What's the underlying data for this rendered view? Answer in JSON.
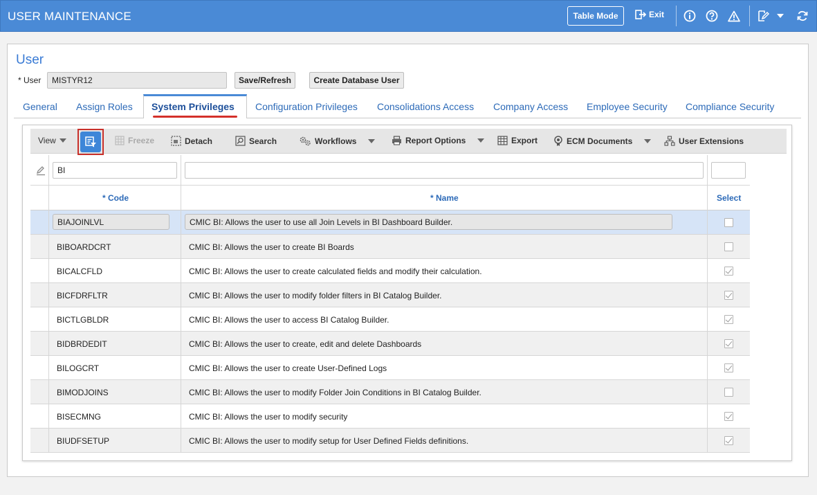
{
  "app": {
    "title": "USER MAINTENANCE",
    "table_mode_label": "Table Mode",
    "exit_label": "Exit"
  },
  "form": {
    "section_title": "User",
    "user_label": "* User",
    "user_value": "MISTYR12",
    "save_refresh_label": "Save/Refresh",
    "create_db_user_label": "Create Database User"
  },
  "tabs": [
    {
      "label": "General"
    },
    {
      "label": "Assign Roles"
    },
    {
      "label": "System Privileges",
      "active": true
    },
    {
      "label": "Configuration Privileges"
    },
    {
      "label": "Consolidations Access"
    },
    {
      "label": "Company Access"
    },
    {
      "label": "Employee Security"
    },
    {
      "label": "Compliance Security"
    }
  ],
  "toolbar": {
    "view_label": "View",
    "freeze_label": "Freeze",
    "detach_label": "Detach",
    "search_label": "Search",
    "workflows_label": "Workflows",
    "report_options_label": "Report Options",
    "export_label": "Export",
    "ecm_documents_label": "ECM Documents",
    "user_extensions_label": "User Extensions"
  },
  "grid": {
    "filter": {
      "code": "BI",
      "name": "",
      "select": ""
    },
    "headers": {
      "code": "* Code",
      "name": "* Name",
      "select": "Select"
    },
    "rows": [
      {
        "code": "BIAJOINLVL",
        "name": "CMIC BI: Allows the user to use all Join Levels in BI Dashboard Builder.",
        "selected": false
      },
      {
        "code": "BIBOARDCRT",
        "name": "CMIC BI: Allows the user to create BI Boards",
        "selected": false
      },
      {
        "code": "BICALCFLD",
        "name": "CMIC BI: Allows the user to create calculated fields and modify their calculation.",
        "selected": true
      },
      {
        "code": "BICFDRFLTR",
        "name": "CMIC BI: Allows the user to modify folder filters in BI Catalog Builder.",
        "selected": true
      },
      {
        "code": "BICTLGBLDR",
        "name": "CMIC BI: Allows the user to access BI Catalog Builder.",
        "selected": true
      },
      {
        "code": "BIDBRDEDIT",
        "name": "CMIC BI: Allows the user to create, edit and delete Dashboards",
        "selected": true
      },
      {
        "code": "BILOGCRT",
        "name": "CMIC BI: Allows the user to create User-Defined Logs",
        "selected": true
      },
      {
        "code": "BIMODJOINS",
        "name": "CMIC BI: Allows the user to modify Folder Join Conditions in BI Catalog Builder.",
        "selected": false
      },
      {
        "code": "BISECMNG",
        "name": "CMIC BI: Allows the user to modify security",
        "selected": true
      },
      {
        "code": "BIUDFSETUP",
        "name": "CMIC BI: Allows the user to modify setup for User Defined Fields definitions.",
        "selected": true
      }
    ]
  },
  "colors": {
    "titlebar": "#4a8ad6",
    "link": "#2c6ab8",
    "highlight": "#c8302a",
    "selected_row": "#d6e4f7"
  }
}
